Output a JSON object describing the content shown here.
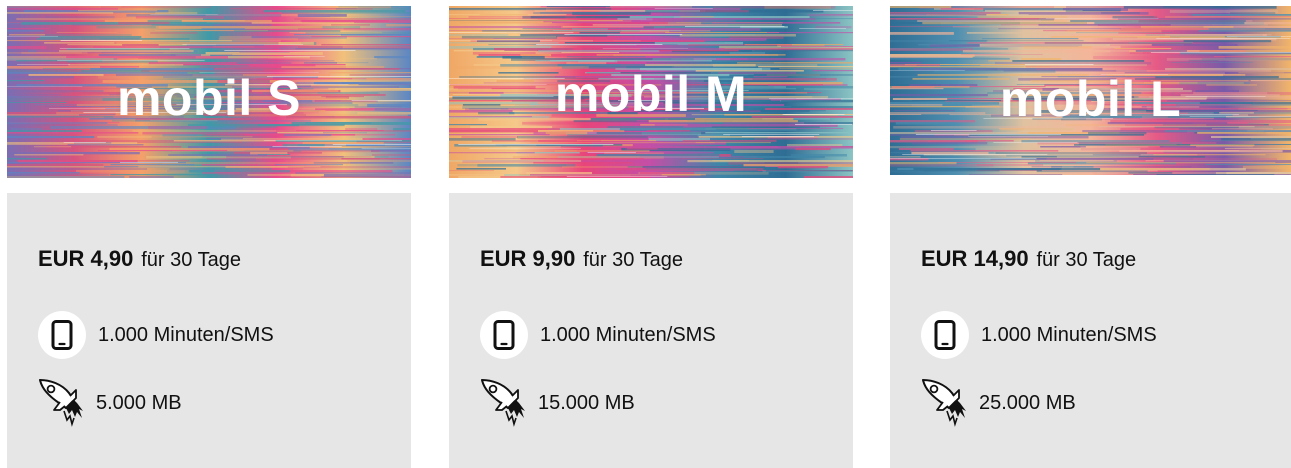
{
  "plans": [
    {
      "name": "mobil S",
      "price_amount": "EUR 4,90",
      "price_period": "für 30 Tage",
      "minutes": "1.000 Minuten/SMS",
      "data": "5.000 MB",
      "banner_colors": [
        "#7b6db3",
        "#d6547e",
        "#f5a06a",
        "#3f9aa8",
        "#e84a8c",
        "#f2c17b",
        "#5a86c4"
      ]
    },
    {
      "name": "mobil M",
      "price_amount": "EUR 9,90",
      "price_period": "für 30 Tage",
      "minutes": "1.000 Minuten/SMS",
      "data": "15.000 MB",
      "banner_colors": [
        "#f0a765",
        "#f5c98a",
        "#e8457a",
        "#c34fa7",
        "#3f86a8",
        "#2f6d94",
        "#8cc4c4"
      ]
    },
    {
      "name": "mobil L",
      "price_amount": "EUR 14,90",
      "price_period": "für 30 Tage",
      "minutes": "1.000 Minuten/SMS",
      "data": "25.000 MB",
      "banner_colors": [
        "#2f6d94",
        "#4f8fb0",
        "#e0c2a0",
        "#f4b59a",
        "#e55a86",
        "#7a5aa8",
        "#f3b56a"
      ]
    }
  ],
  "icons": {
    "minutes": "smartphone-icon",
    "data": "rocket-icon"
  }
}
